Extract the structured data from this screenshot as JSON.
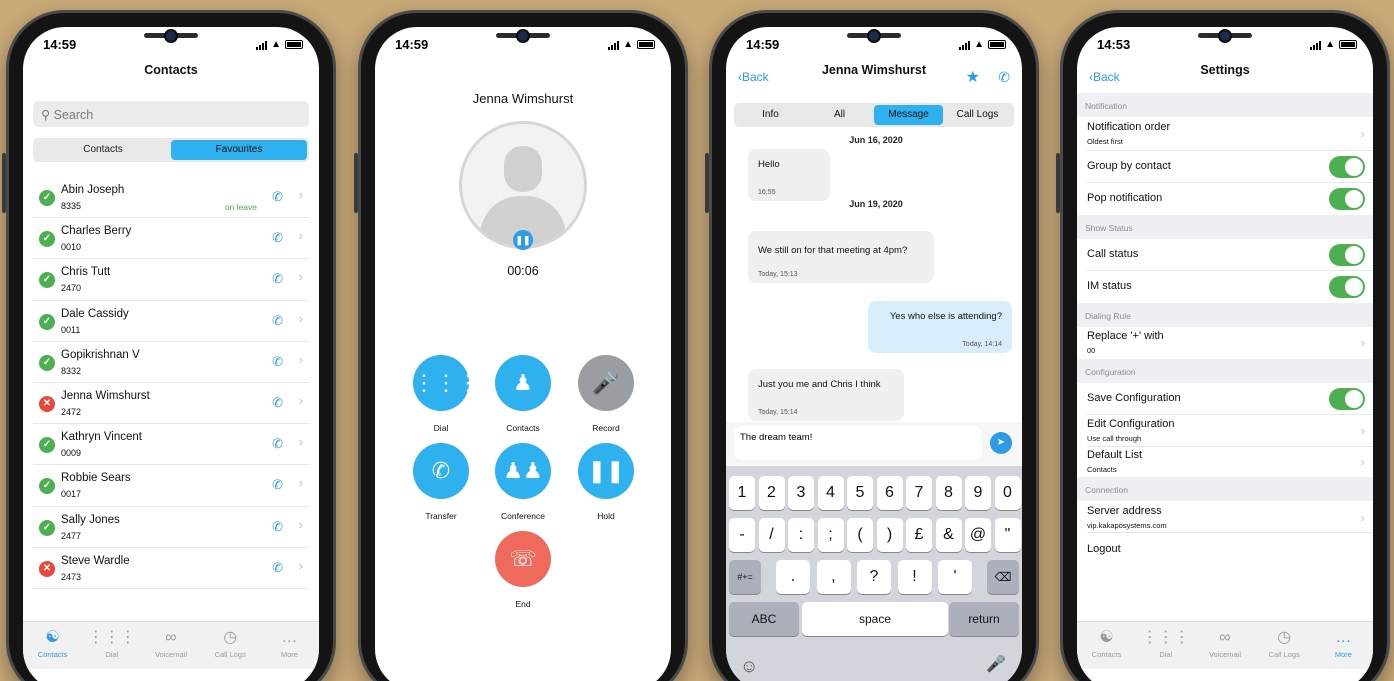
{
  "status_times": [
    "14:59",
    "14:59",
    "14:59",
    "14:53"
  ],
  "contacts_screen": {
    "title": "Contacts",
    "search_placeholder": "Search",
    "segments": [
      "Contacts",
      "Favourites"
    ],
    "rows": [
      {
        "name": "Abin Joseph",
        "ext": "8335",
        "note": "on leave",
        "status": "ok"
      },
      {
        "name": "Charles Berry",
        "ext": "0010",
        "note": "",
        "status": "ok"
      },
      {
        "name": "Chris Tutt",
        "ext": "2470",
        "note": "",
        "status": "ok"
      },
      {
        "name": "Dale Cassidy",
        "ext": "0011",
        "note": "",
        "status": "ok"
      },
      {
        "name": "Gopikrishnan V",
        "ext": "8332",
        "note": "",
        "status": "ok"
      },
      {
        "name": "Jenna Wimshurst",
        "ext": "2472",
        "note": "",
        "status": "busy"
      },
      {
        "name": "Kathryn Vincent",
        "ext": "0009",
        "note": "",
        "status": "ok"
      },
      {
        "name": "Robbie Sears",
        "ext": "0017",
        "note": "",
        "status": "ok"
      },
      {
        "name": "Sally Jones",
        "ext": "2477",
        "note": "",
        "status": "ok"
      },
      {
        "name": "Steve Wardle",
        "ext": "2473",
        "note": "",
        "status": "busy"
      }
    ]
  },
  "tabbar": [
    "Contacts",
    "Dial",
    "Voicemail",
    "Call Logs",
    "More"
  ],
  "call_screen": {
    "name": "Jenna Wimshurst",
    "timer": "00:06",
    "buttons": {
      "dial": "Dial",
      "contacts": "Contacts",
      "record": "Record",
      "transfer": "Transfer",
      "conference": "Conference",
      "hold": "Hold",
      "end": "End"
    }
  },
  "message_screen": {
    "back": "Back",
    "name": "Jenna Wimshurst",
    "segments": [
      "Info",
      "All",
      "Message",
      "Call Logs"
    ],
    "date1": "Jun 16, 2020",
    "date2": "Jun 19, 2020",
    "messages": [
      {
        "text": "Hello",
        "time": "16:55"
      },
      {
        "text": "We still on for that meeting at 4pm?",
        "time": "Today, 15:13"
      },
      {
        "text": "Yes who else is attending?",
        "time": "Today, 14:14"
      },
      {
        "text": "Just you me and Chris I think",
        "time": "Today, 15:14"
      }
    ],
    "draft": "The dream team!",
    "keys_row1": [
      "1",
      "2",
      "3",
      "4",
      "5",
      "6",
      "7",
      "8",
      "9",
      "0"
    ],
    "keys_row2": [
      "-",
      "/",
      ":",
      ";",
      "(",
      ")",
      "£",
      "&",
      "@",
      "\""
    ],
    "keys_row3": [
      ".",
      ",",
      "?",
      "!",
      "'"
    ],
    "key_symbols": "#+=",
    "key_abc": "ABC",
    "key_space": "space",
    "key_return": "return"
  },
  "settings_screen": {
    "back": "Back",
    "title": "Settings",
    "groups": {
      "notification": "Notification",
      "show_status": "Show Status",
      "dialing_rule": "Dialing Rule",
      "configuration": "Configuration",
      "connection": "Connection"
    },
    "rows": {
      "notification_order": "Notification order",
      "notification_order_sub": "Oldest first",
      "group_by_contact": "Group by contact",
      "pop_notification": "Pop notification",
      "call_status": "Call status",
      "im_status": "IM status",
      "replace": "Replace '+' with",
      "replace_sub": "00",
      "save_config": "Save Configuration",
      "edit_config": "Edit Configuration",
      "edit_config_sub": "Use call through",
      "default_list": "Default List",
      "default_list_sub": "Contacts",
      "server": "Server address",
      "server_sub": "vip.kakaposystems.com",
      "logout": "Logout"
    }
  }
}
